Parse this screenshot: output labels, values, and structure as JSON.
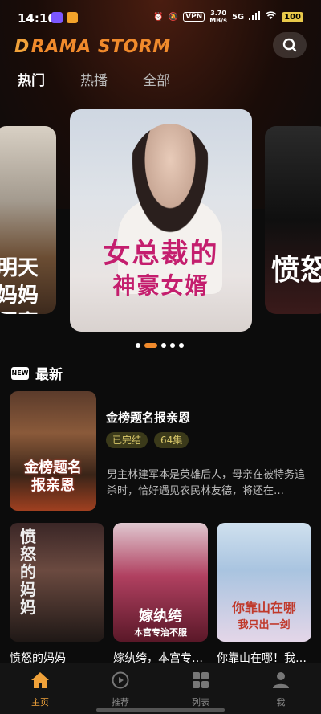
{
  "status_bar": {
    "time": "14:16",
    "vpn": "VPN",
    "speed_value": "3.70",
    "speed_unit": "MB/s",
    "network": "5G",
    "battery": "100"
  },
  "header": {
    "logo_text": "RAMA STORM",
    "logo_mark": "D"
  },
  "tabs": [
    {
      "label": "热门",
      "active": true
    },
    {
      "label": "热播",
      "active": false
    },
    {
      "label": "全部",
      "active": false
    }
  ],
  "carousel": {
    "left_card_text": [
      "明天",
      "妈妈回家"
    ],
    "main_card_title_line1": "女总裁的",
    "main_card_title_line2": "神豪女婿",
    "right_card_text": "愤怒",
    "dot_count": 5,
    "active_dot": 1
  },
  "newest": {
    "section_title": "最新",
    "new_icon_label": "NEW",
    "feature": {
      "poster_text": [
        "金榜题名",
        "报亲恩"
      ],
      "title": "金榜题名报亲恩",
      "status_tag": "已完结",
      "episodes_tag": "64集",
      "description": "男主林建军本是英雄后人，母亲在被特务追杀时，恰好遇见农民林友德，将还在…"
    },
    "grid": [
      {
        "title": "愤怒的妈妈",
        "poster_text": [
          "愤",
          "怒",
          "的",
          "妈",
          "妈"
        ]
      },
      {
        "title": "嫁纨绔，本宫专…",
        "poster_text": [
          "嫁纨绔",
          "本宫专治不服"
        ]
      },
      {
        "title": "你靠山在哪！我…",
        "poster_text": [
          "你靠山在哪",
          "我只出一剑"
        ]
      }
    ]
  },
  "bottom_nav": [
    {
      "label": "主页",
      "icon": "home-icon",
      "active": true
    },
    {
      "label": "推荐",
      "icon": "play-circle-icon",
      "active": false
    },
    {
      "label": "列表",
      "icon": "grid-icon",
      "active": false
    },
    {
      "label": "我",
      "icon": "user-icon",
      "active": false
    }
  ],
  "colors": {
    "accent": "#f08a2c",
    "active_nav": "#f0a23a",
    "background": "#0c0c0c"
  }
}
